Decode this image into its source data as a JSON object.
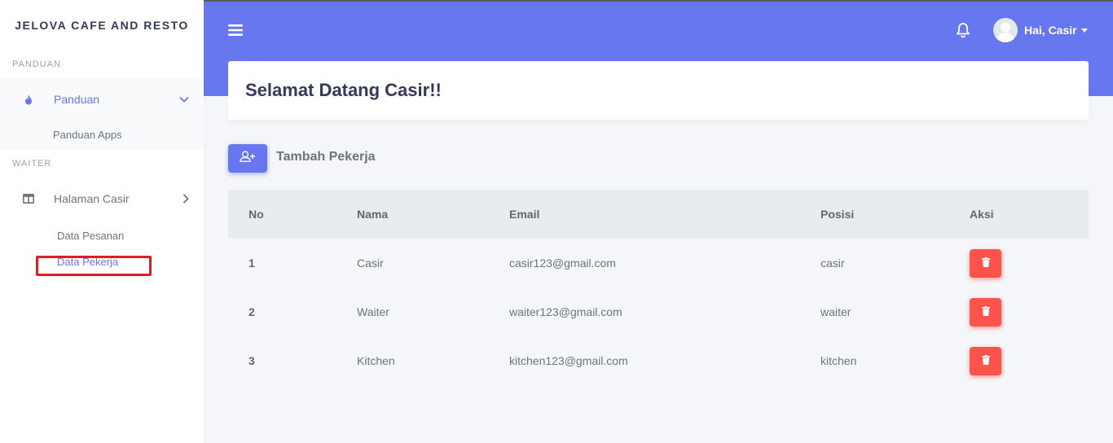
{
  "sidebar": {
    "brand": "JELOVA CAFE AND RESTO",
    "section1": "PANDUAN",
    "panduan_label": "Panduan",
    "panduan_apps": "Panduan Apps",
    "section2": "WAITER",
    "halaman_casir": "Halaman Casir",
    "data_pesanan": "Data Pesanan",
    "data_pekerja": "Data Pekerja"
  },
  "navbar": {
    "user_greeting": "Hai, Casir"
  },
  "header": {
    "title": "Selamat Datang Casir!!"
  },
  "actions": {
    "add_label": "Tambah Pekerja"
  },
  "table": {
    "headers": [
      "No",
      "Nama",
      "Email",
      "Posisi",
      "Aksi"
    ],
    "rows": [
      {
        "no": "1",
        "nama": "Casir",
        "email": "casir123@gmail.com",
        "posisi": "casir"
      },
      {
        "no": "2",
        "nama": "Waiter",
        "email": "waiter123@gmail.com",
        "posisi": "waiter"
      },
      {
        "no": "3",
        "nama": "Kitchen",
        "email": "kitchen123@gmail.com",
        "posisi": "kitchen"
      }
    ]
  },
  "colors": {
    "primary": "#6777ef",
    "danger": "#fc544b",
    "highlight": "#e31b23"
  }
}
